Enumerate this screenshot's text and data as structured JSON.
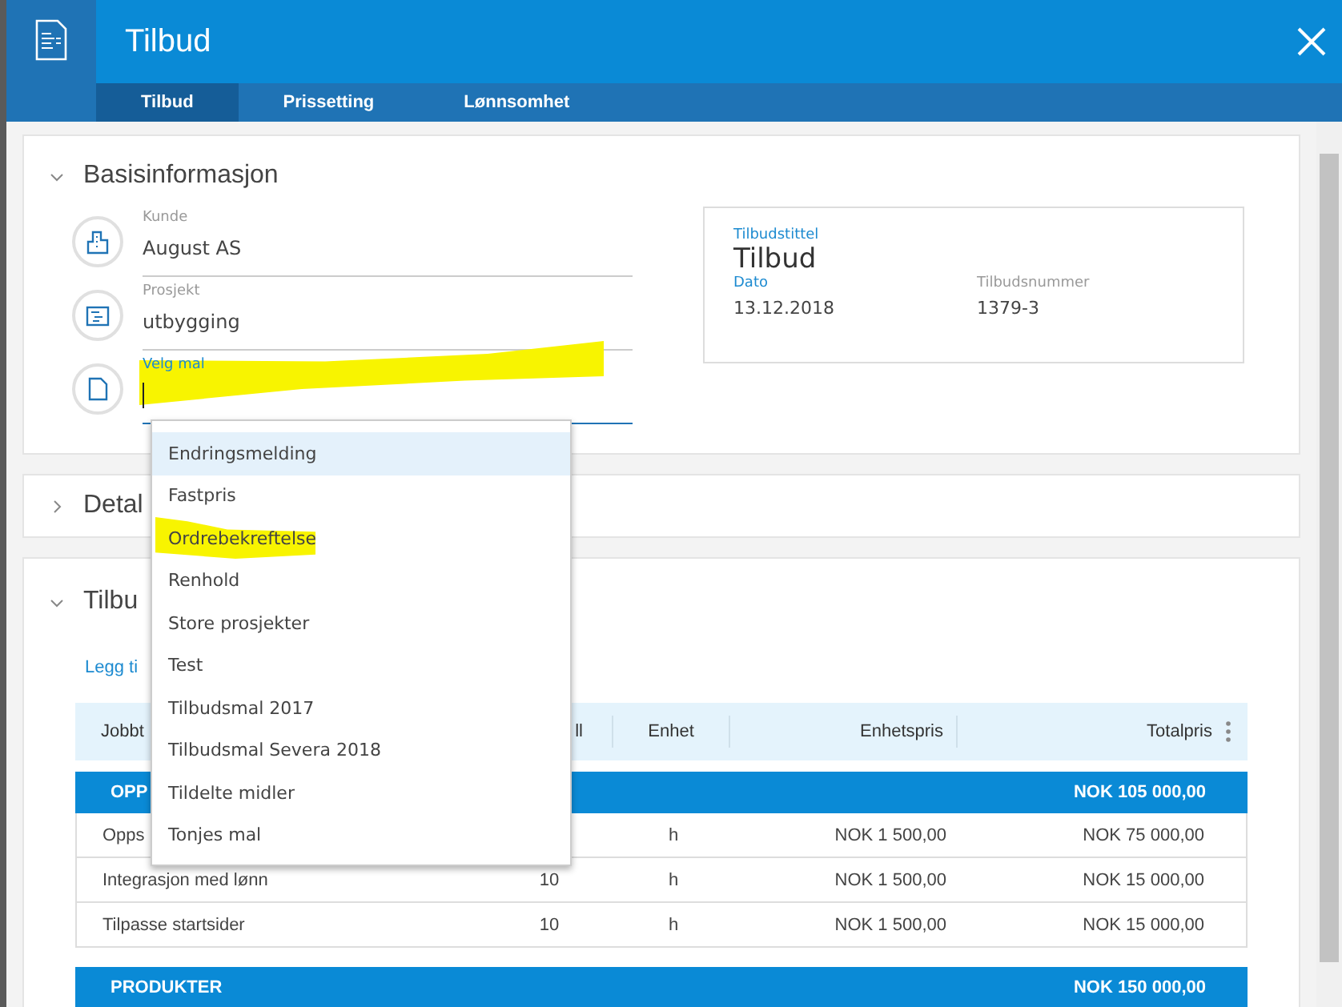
{
  "window": {
    "title": "Tilbud"
  },
  "tabs": [
    {
      "label": "Tilbud",
      "selected": true
    },
    {
      "label": "Prissetting",
      "selected": false
    },
    {
      "label": "Lønnsomhet",
      "selected": false
    }
  ],
  "basis": {
    "title": "Basisinformasjon",
    "expanded": true,
    "fields": [
      {
        "kind": "building",
        "label": "Kunde",
        "value": "August AS",
        "focused": false,
        "marker": false
      },
      {
        "kind": "folder",
        "label": "Prosjekt",
        "value": "utbygging",
        "focused": false,
        "marker": false
      },
      {
        "kind": "document",
        "label": "Velg mal",
        "focused": true,
        "marker": true
      }
    ],
    "summary": {
      "title_label": "Tilbudstittel",
      "title": "Tilbud",
      "date_label": "Dato",
      "date": "13.12.2018",
      "number_label": "Tilbudsnummer",
      "number": "1379-3"
    }
  },
  "details": {
    "title": "Detal",
    "expanded": false
  },
  "offer": {
    "title": "Tilbu",
    "expanded": true,
    "add_link": "Legg ti",
    "columns": [
      "Jobbt",
      "ll",
      "Enhet",
      "Enhetspris",
      "Totalpris"
    ],
    "groups": [
      {
        "name": "OPP",
        "total": "NOK 105 000,00",
        "rows": [
          [
            "Opps",
            "",
            "h",
            "NOK 1 500,00",
            "NOK 75 000,00"
          ],
          [
            "Integrasjon med lønn",
            "10",
            "h",
            "NOK 1 500,00",
            "NOK 15 000,00"
          ],
          [
            "Tilpasse startsider",
            "10",
            "h",
            "NOK 1 500,00",
            "NOK 15 000,00"
          ]
        ]
      },
      {
        "name": "PRODUKTER",
        "total": "NOK 150 000,00"
      }
    ]
  },
  "dropdown": {
    "options": [
      {
        "label": "Endringsmelding",
        "selected": true,
        "marker": false
      },
      {
        "label": "Fastpris",
        "selected": false,
        "marker": false
      },
      {
        "label": "Ordrebekreftelse",
        "selected": false,
        "marker": true
      },
      {
        "label": "Renhold",
        "selected": false,
        "marker": false
      },
      {
        "label": "Store prosjekter",
        "selected": false,
        "marker": false
      },
      {
        "label": "Test",
        "selected": false,
        "marker": false
      },
      {
        "label": "Tilbudsmal 2017",
        "selected": false,
        "marker": false
      },
      {
        "label": "Tilbudsmal Severa 2018",
        "selected": false,
        "marker": false
      },
      {
        "label": "Tildelte midler",
        "selected": false,
        "marker": false
      },
      {
        "label": "Tonjes mal",
        "selected": false,
        "marker": false
      }
    ]
  }
}
